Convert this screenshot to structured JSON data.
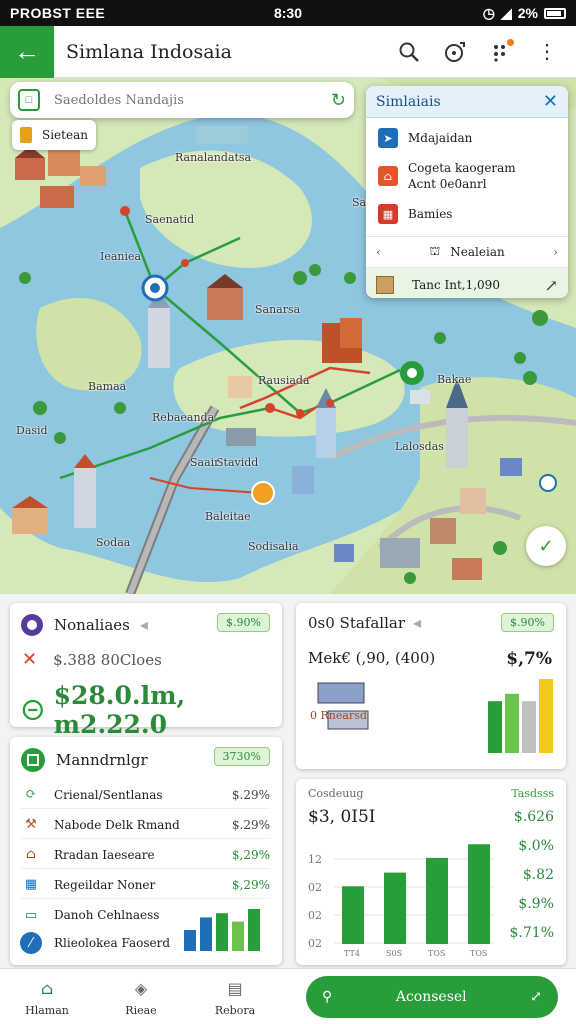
{
  "status_bar": {
    "carrier": "PROBST EEE",
    "time": "8:30",
    "battery": "2%"
  },
  "app_bar": {
    "title": "Simlana Indosaia"
  },
  "search": {
    "placeholder": "Saedoldes Nandajis"
  },
  "chip": {
    "label": "Sietean"
  },
  "map_labels": [
    "Ranalandatsa",
    "Saenatid",
    "Ieaniea",
    "Sanarsa",
    "Bamaa",
    "Rausiada",
    "Rebaeanda",
    "Stavidd",
    "Baleitae",
    "Sodaa",
    "Sodisalia",
    "Bakae",
    "Dasid",
    "Saair",
    "Sarf",
    "Lalosdas"
  ],
  "layers_panel": {
    "title": "Simlaiais",
    "items": [
      {
        "label": "Mdajaidan",
        "icon": "transit-icon",
        "color": "#1f6fb8"
      },
      {
        "label": "Cogeta kaogeram",
        "label2": "Acnt 0e0anrl",
        "icon": "poi-icon",
        "color": "#e0562a"
      },
      {
        "label": "Bamies",
        "icon": "grid-icon",
        "color": "#d63a2a"
      }
    ],
    "nav_label": "Nealeian",
    "footer_label": "Tanc Int,1,090"
  },
  "card_overview": {
    "title": "Nonaliaes",
    "pill": "$.90%",
    "sub": "$.388 80Cloes",
    "big": "$28.0.lm, m2.22.0"
  },
  "card_stat": {
    "title": "0s0 Stafallar",
    "pill": "$.90%",
    "line_label": "Mek€ (,90, (400)",
    "line_value": "$,7%",
    "building_label": "0 Rnearsd",
    "bar_values": [
      0.7,
      0.8,
      0.7,
      1.0
    ],
    "bar_colors": [
      "#2a9d3b",
      "#6cc24a",
      "#bfbfbf",
      "#f2c81a"
    ]
  },
  "card_metrics": {
    "title": "Manndrnlgr",
    "pill": "3730%",
    "rows": [
      {
        "label": "Crienal/Sentlanas",
        "value": "$.29%",
        "icon": "sync-icon",
        "green": false
      },
      {
        "label": "Nabode Delk Rmand",
        "value": "$.29%",
        "icon": "construction-icon",
        "green": false
      },
      {
        "label": "Rradan Iaeseare",
        "value": "$,29%",
        "icon": "house-icon",
        "green": true
      },
      {
        "label": "Regeildar Noner",
        "value": "$,29%",
        "icon": "grid-icon",
        "green": true
      },
      {
        "label": "Danoh Cehlnaess",
        "value": "",
        "icon": "card-icon",
        "green": false
      },
      {
        "label": "Rlieolokea Faoserd",
        "value": "",
        "icon": "slash-icon",
        "green": false
      }
    ],
    "mini_bars": [
      0.5,
      0.8,
      0.9,
      0.7,
      1.0
    ]
  },
  "card_chart": {
    "title": "Cosdeuug",
    "legend": "Tasdsss",
    "headline": "$3, 0I5I",
    "values_right": [
      "$.626",
      "$.0%",
      "$.82",
      "$.9%",
      "$.71%"
    ],
    "y_ticks": [
      "12",
      "02",
      "02",
      "02"
    ],
    "x_ticks": [
      "TT4",
      "S0S",
      "TOS",
      "TOS"
    ]
  },
  "chart_data": {
    "type": "bar",
    "categories": [
      "TT4",
      "S0S",
      "TOS",
      "TOS"
    ],
    "values": [
      0.55,
      0.68,
      0.82,
      0.95
    ],
    "title": "Cosdeuug",
    "xlabel": "",
    "ylabel": ""
  },
  "bottom_nav": {
    "items": [
      {
        "label": "Hlaman",
        "icon": "home-icon"
      },
      {
        "label": "Rieae",
        "icon": "shield-icon"
      },
      {
        "label": "Rebora",
        "icon": "document-icon"
      }
    ],
    "cta": "Aconsesel"
  },
  "colors": {
    "accent": "#2a9d3b",
    "water": "#8fc6e0",
    "land": "#d5e8b8",
    "panel_header": "#e4f1fb"
  }
}
